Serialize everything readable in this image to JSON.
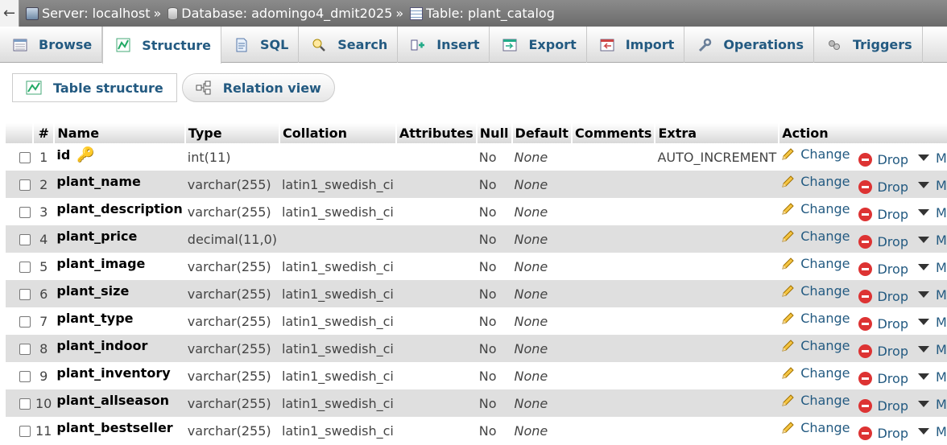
{
  "breadcrumb": {
    "back": "←",
    "server": "Server: localhost",
    "database": "Database: adomingo4_dmit2025",
    "table": "Table: plant_catalog",
    "separator": "»"
  },
  "tabs": [
    {
      "label": "Browse",
      "icon": "browse-icon",
      "active": false
    },
    {
      "label": "Structure",
      "icon": "structure-icon",
      "active": true
    },
    {
      "label": "SQL",
      "icon": "sql-icon",
      "active": false
    },
    {
      "label": "Search",
      "icon": "search-icon",
      "active": false
    },
    {
      "label": "Insert",
      "icon": "insert-icon",
      "active": false
    },
    {
      "label": "Export",
      "icon": "export-icon",
      "active": false
    },
    {
      "label": "Import",
      "icon": "import-icon",
      "active": false
    },
    {
      "label": "Operations",
      "icon": "wrench-icon",
      "active": false
    },
    {
      "label": "Triggers",
      "icon": "triggers-icon",
      "active": false
    }
  ],
  "subtabs": [
    {
      "label": "Table structure",
      "icon": "table-structure-icon"
    },
    {
      "label": "Relation view",
      "icon": "relation-view-icon"
    }
  ],
  "columns": [
    "#",
    "Name",
    "Type",
    "Collation",
    "Attributes",
    "Null",
    "Default",
    "Comments",
    "Extra",
    "Action"
  ],
  "actions": {
    "change": "Change",
    "drop": "Drop",
    "more": "More"
  },
  "rows": [
    {
      "num": "1",
      "name": "id",
      "primary": true,
      "type": "int(11)",
      "collation": "",
      "attributes": "",
      "null": "No",
      "default": "None",
      "comments": "",
      "extra": "AUTO_INCREMENT"
    },
    {
      "num": "2",
      "name": "plant_name",
      "primary": false,
      "type": "varchar(255)",
      "collation": "latin1_swedish_ci",
      "attributes": "",
      "null": "No",
      "default": "None",
      "comments": "",
      "extra": ""
    },
    {
      "num": "3",
      "name": "plant_description",
      "primary": false,
      "type": "varchar(255)",
      "collation": "latin1_swedish_ci",
      "attributes": "",
      "null": "No",
      "default": "None",
      "comments": "",
      "extra": ""
    },
    {
      "num": "4",
      "name": "plant_price",
      "primary": false,
      "type": "decimal(11,0)",
      "collation": "",
      "attributes": "",
      "null": "No",
      "default": "None",
      "comments": "",
      "extra": ""
    },
    {
      "num": "5",
      "name": "plant_image",
      "primary": false,
      "type": "varchar(255)",
      "collation": "latin1_swedish_ci",
      "attributes": "",
      "null": "No",
      "default": "None",
      "comments": "",
      "extra": ""
    },
    {
      "num": "6",
      "name": "plant_size",
      "primary": false,
      "type": "varchar(255)",
      "collation": "latin1_swedish_ci",
      "attributes": "",
      "null": "No",
      "default": "None",
      "comments": "",
      "extra": ""
    },
    {
      "num": "7",
      "name": "plant_type",
      "primary": false,
      "type": "varchar(255)",
      "collation": "latin1_swedish_ci",
      "attributes": "",
      "null": "No",
      "default": "None",
      "comments": "",
      "extra": ""
    },
    {
      "num": "8",
      "name": "plant_indoor",
      "primary": false,
      "type": "varchar(255)",
      "collation": "latin1_swedish_ci",
      "attributes": "",
      "null": "No",
      "default": "None",
      "comments": "",
      "extra": ""
    },
    {
      "num": "9",
      "name": "plant_inventory",
      "primary": false,
      "type": "varchar(255)",
      "collation": "latin1_swedish_ci",
      "attributes": "",
      "null": "No",
      "default": "None",
      "comments": "",
      "extra": ""
    },
    {
      "num": "10",
      "name": "plant_allseason",
      "primary": false,
      "type": "varchar(255)",
      "collation": "latin1_swedish_ci",
      "attributes": "",
      "null": "No",
      "default": "None",
      "comments": "",
      "extra": ""
    },
    {
      "num": "11",
      "name": "plant_bestseller",
      "primary": false,
      "type": "varchar(255)",
      "collation": "latin1_swedish_ci",
      "attributes": "",
      "null": "No",
      "default": "None",
      "comments": "",
      "extra": ""
    }
  ]
}
